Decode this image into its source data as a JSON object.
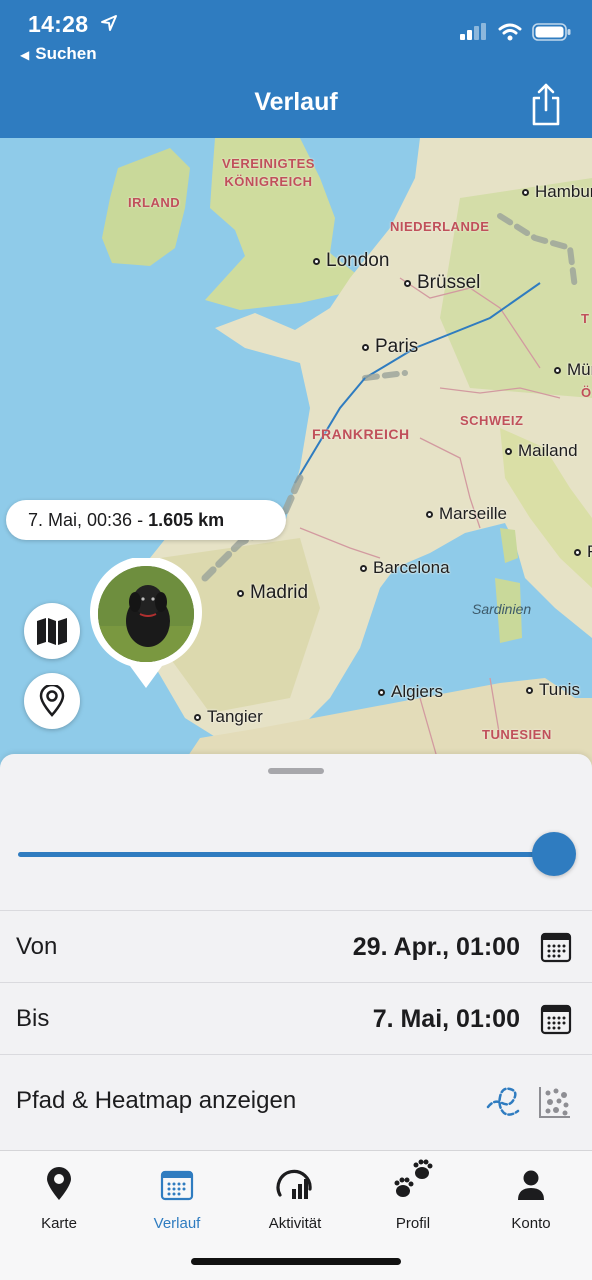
{
  "status_bar": {
    "time": "14:28",
    "back_label": "Suchen"
  },
  "header": {
    "title": "Verlauf",
    "share_icon": "share-icon"
  },
  "map": {
    "cities": [
      {
        "id": "london",
        "name": "London"
      },
      {
        "id": "bruessel",
        "name": "Brüssel"
      },
      {
        "id": "paris",
        "name": "Paris"
      },
      {
        "id": "hamburg",
        "name": "Hambur"
      },
      {
        "id": "muenchen",
        "name": "Mün"
      },
      {
        "id": "mailand",
        "name": "Mailand"
      },
      {
        "id": "marseille",
        "name": "Marseille"
      },
      {
        "id": "barcelona",
        "name": "Barcelona"
      },
      {
        "id": "madrid",
        "name": "Madrid"
      },
      {
        "id": "algiers",
        "name": "Algiers"
      },
      {
        "id": "tunis",
        "name": "Tunis"
      },
      {
        "id": "tangier",
        "name": "Tangier"
      },
      {
        "id": "r",
        "name": "R"
      }
    ],
    "countries": {
      "uk": "VEREINIGTES\nKÖNIGREICH",
      "irland": "IRLAND",
      "niederlande": "NIEDERLANDE",
      "frankreich": "FRANKREICH",
      "schweiz": "SCHWEIZ",
      "tunesien": "TUNESIEN",
      "t": "T",
      "oe": "Ö"
    },
    "sea": "Sardinien",
    "distance": {
      "date": "7. Mai, 00:36",
      "separator": " - ",
      "km": "1.605 km"
    },
    "buttons": {
      "map_type_icon": "map-icon",
      "location_icon": "location-pin-icon"
    },
    "path_color": "#2f7cc0"
  },
  "sheet": {
    "slider_value": 1.0,
    "von_label": "Von",
    "von_value": "29. Apr., 01:00",
    "bis_label": "Bis",
    "bis_value": "7. Mai, 01:00",
    "path_label": "Pfad & Heatmap anzeigen",
    "path_icon": "path-icon",
    "heatmap_icon": "heatmap-icon"
  },
  "tabbar": {
    "tabs": [
      {
        "id": "karte",
        "label": "Karte",
        "icon": "map-pin-icon"
      },
      {
        "id": "verlauf",
        "label": "Verlauf",
        "icon": "calendar-icon",
        "active": true
      },
      {
        "id": "aktivitaet",
        "label": "Aktivität",
        "icon": "activity-gauge-icon"
      },
      {
        "id": "profil",
        "label": "Profil",
        "icon": "paws-icon"
      },
      {
        "id": "konto",
        "label": "Konto",
        "icon": "person-icon"
      }
    ]
  },
  "colors": {
    "accent": "#2f7cc0",
    "sea": "#8fcbe9",
    "land": "#e8e3c8",
    "country_label": "#c0505a"
  }
}
